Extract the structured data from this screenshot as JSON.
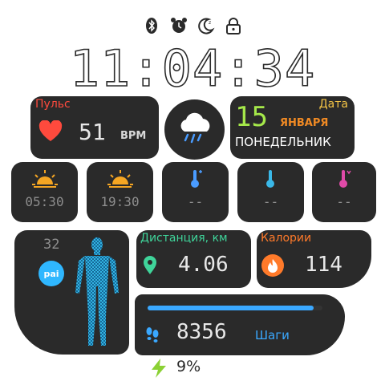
{
  "status": {
    "icons": [
      "bluetooth-icon",
      "alarm-icon",
      "moon-icon",
      "lock-icon"
    ]
  },
  "time": "11:04:34",
  "heart": {
    "label": "Пульс",
    "value": "51",
    "unit": "BPM"
  },
  "date": {
    "label": "Дата",
    "day": "15",
    "month": "ЯНВАРЯ",
    "weekday": "ПОНЕДЕЛЬНИК"
  },
  "weather": {
    "icon": "rain-cloud-icon"
  },
  "tiles": [
    {
      "icon": "sunrise-icon",
      "value": "05:30"
    },
    {
      "icon": "sunset-icon",
      "value": "19:30"
    },
    {
      "icon": "thermometer-max-icon",
      "value": "--"
    },
    {
      "icon": "thermometer-icon",
      "value": "--"
    },
    {
      "icon": "thermometer-min-icon",
      "value": "--"
    }
  ],
  "pai": {
    "value": "32",
    "badge": "pai"
  },
  "distance": {
    "label": "Дистанция, км",
    "value": "4.06"
  },
  "calories": {
    "label": "Калории",
    "value": "114"
  },
  "steps": {
    "value": "8356",
    "label": "Шаги",
    "progress": 0.95
  },
  "battery": {
    "value": "9%"
  },
  "colors": {
    "heart": "#ff4a3d",
    "date_day": "#a5e84a",
    "date_label": "#f6c646",
    "month": "#f08a24",
    "distance": "#3fd49a",
    "calories": "#ff7a2a",
    "steps": "#3aa8ff",
    "pai": "#2fb7ff",
    "battery": "#8bd134"
  }
}
